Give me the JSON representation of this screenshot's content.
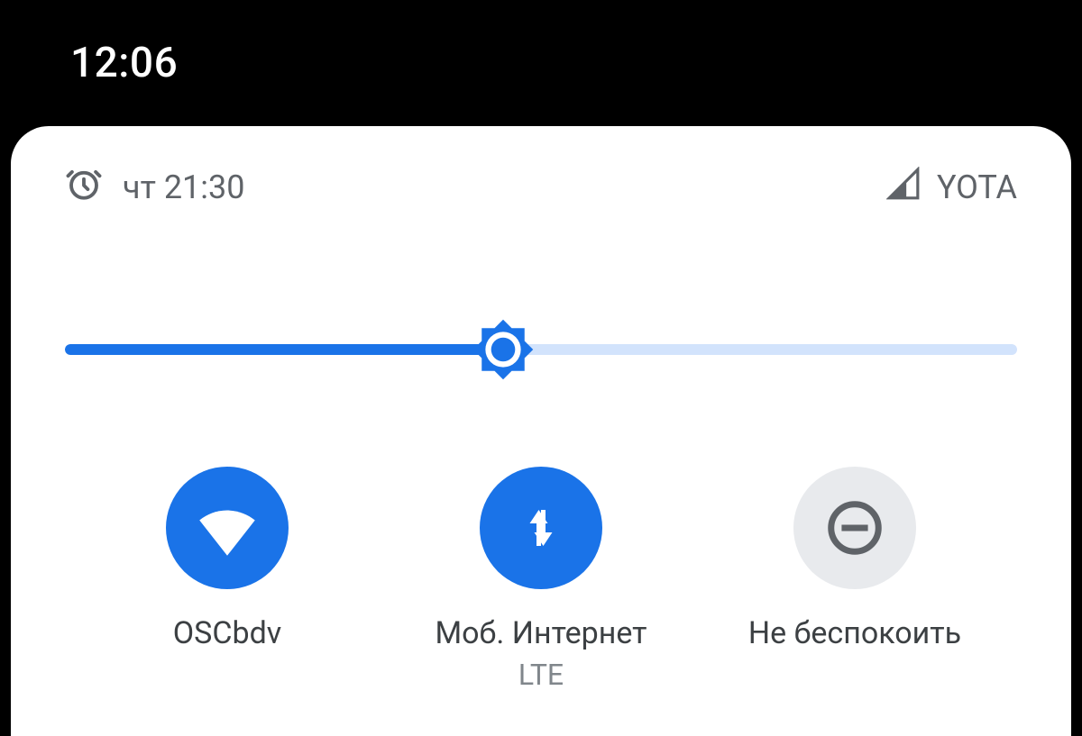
{
  "statusbar": {
    "time": "12:06"
  },
  "header": {
    "alarm_time": "чт 21:30",
    "carrier": "YOTA"
  },
  "brightness": {
    "percent": 46
  },
  "tiles": {
    "wifi": {
      "label": "OSCbdv",
      "sub": ""
    },
    "mobile": {
      "label": "Моб. Интернет",
      "sub": "LTE"
    },
    "dnd": {
      "label": "Не беспокоить",
      "sub": ""
    }
  },
  "colors": {
    "accent": "#1a73e8",
    "track": "#d2e3fc",
    "tile_off": "#e8eaed"
  }
}
